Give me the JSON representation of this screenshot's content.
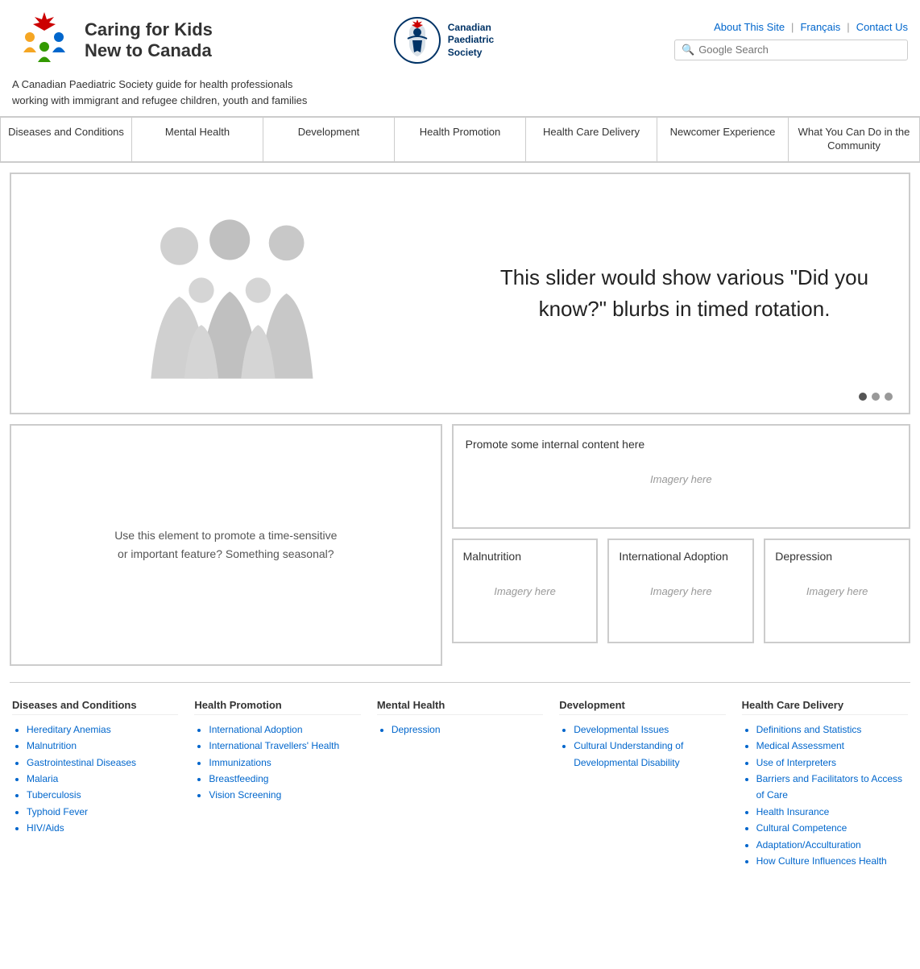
{
  "header": {
    "site_name_line1": "Caring for Kids",
    "site_name_line2": "New to Canada",
    "tagline_line1": "A Canadian Paediatric Society guide for health professionals",
    "tagline_line2": "working with immigrant and refugee children, youth and families",
    "links": {
      "about": "About This Site",
      "francais": "Français",
      "contact": "Contact Us"
    },
    "cps_name_line1": "Canadian",
    "cps_name_line2": "Paediatric",
    "cps_name_line3": "Society",
    "search_placeholder": "Google Search"
  },
  "nav": {
    "items": [
      {
        "id": "diseases",
        "label": "Diseases and Conditions"
      },
      {
        "id": "mental-health",
        "label": "Mental Health"
      },
      {
        "id": "development",
        "label": "Development"
      },
      {
        "id": "health-promotion",
        "label": "Health Promotion"
      },
      {
        "id": "health-care-delivery",
        "label": "Health Care Delivery"
      },
      {
        "id": "newcomer-experience",
        "label": "Newcomer Experience"
      },
      {
        "id": "community",
        "label": "What You Can Do in the Community"
      }
    ]
  },
  "slider": {
    "text": "This slider would show various \"Did you know?\" blurbs in timed rotation.",
    "dots": [
      {
        "active": true
      },
      {
        "active": false
      },
      {
        "active": false
      }
    ]
  },
  "promo_left": {
    "text_line1": "Use this element to promote a time-sensitive",
    "text_line2": "or important feature? Something seasonal?"
  },
  "promo_right": {
    "top_title": "Promote some internal content here",
    "top_imagery": "Imagery here",
    "cards": [
      {
        "title": "Malnutrition",
        "imagery": "Imagery here"
      },
      {
        "title": "International Adoption",
        "imagery": "Imagery here"
      },
      {
        "title": "Depression",
        "imagery": "Imagery here"
      }
    ]
  },
  "footer": {
    "columns": [
      {
        "heading": "Diseases and Conditions",
        "items": [
          "Hereditary Anemias",
          "Malnutrition",
          "Gastrointestinal Diseases",
          "Malaria",
          "Tuberculosis",
          "Typhoid Fever",
          "HIV/Aids"
        ]
      },
      {
        "heading": "Health Promotion",
        "items": [
          "International Adoption",
          "International Travellers' Health",
          "Immunizations",
          "Breastfeeding",
          "Vision Screening"
        ]
      },
      {
        "heading": "Mental Health",
        "items": [
          "Depression"
        ]
      },
      {
        "heading": "Development",
        "items": [
          "Developmental Issues",
          "Cultural Understanding of Developmental Disability"
        ]
      },
      {
        "heading": "Health Care Delivery",
        "items": [
          "Definitions and Statistics",
          "Medical Assessment",
          "Use of Interpreters",
          "Barriers and Facilitators to Access of Care",
          "Health Insurance",
          "Cultural Competence",
          "Adaptation/Acculturation",
          "How Culture Influences Health"
        ]
      }
    ]
  }
}
